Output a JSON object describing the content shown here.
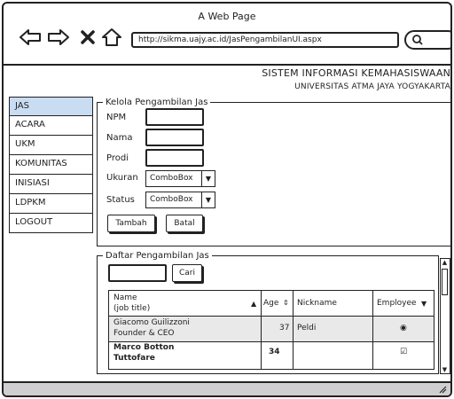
{
  "browser": {
    "title": "A Web Page",
    "url": "http://sikma.uajy.ac.id/JasPengambilanUI.aspx"
  },
  "header": {
    "system_title": "SISTEM INFORMASI KEMAHASISWAAN",
    "university": "UNIVERSITAS ATMA JAYA YOGYAKARTA"
  },
  "sidebar": {
    "items": [
      {
        "label": "JAS",
        "active": true
      },
      {
        "label": "ACARA"
      },
      {
        "label": "UKM"
      },
      {
        "label": "KOMUNITAS"
      },
      {
        "label": "INISIASI"
      },
      {
        "label": "LDPKM"
      },
      {
        "label": "LOGOUT"
      }
    ]
  },
  "kelola": {
    "legend": "Kelola Pengambilan Jas",
    "npm_label": "NPM",
    "nama_label": "Nama",
    "prodi_label": "Prodi",
    "ukuran_label": "Ukuran",
    "status_label": "Status",
    "ukuran_combo": "ComboBox",
    "status_combo": "ComboBox",
    "tambah_button": "Tambah",
    "batal_button": "Batal"
  },
  "daftar": {
    "legend": "Daftar Pengambilan Jas",
    "cari_button": "Cari",
    "table": {
      "columns": [
        "Name",
        "(job title)",
        "Age",
        "Nickname",
        "Employee"
      ],
      "rows": [
        {
          "name": "Giacomo Guilizzoni",
          "title": "Founder & CEO",
          "age": "37",
          "nickname": "Peldi",
          "employee": "◉"
        },
        {
          "name": "Marco Botton",
          "title": "Tuttofare",
          "age": "34",
          "nickname": "",
          "employee": "☑"
        }
      ]
    }
  }
}
